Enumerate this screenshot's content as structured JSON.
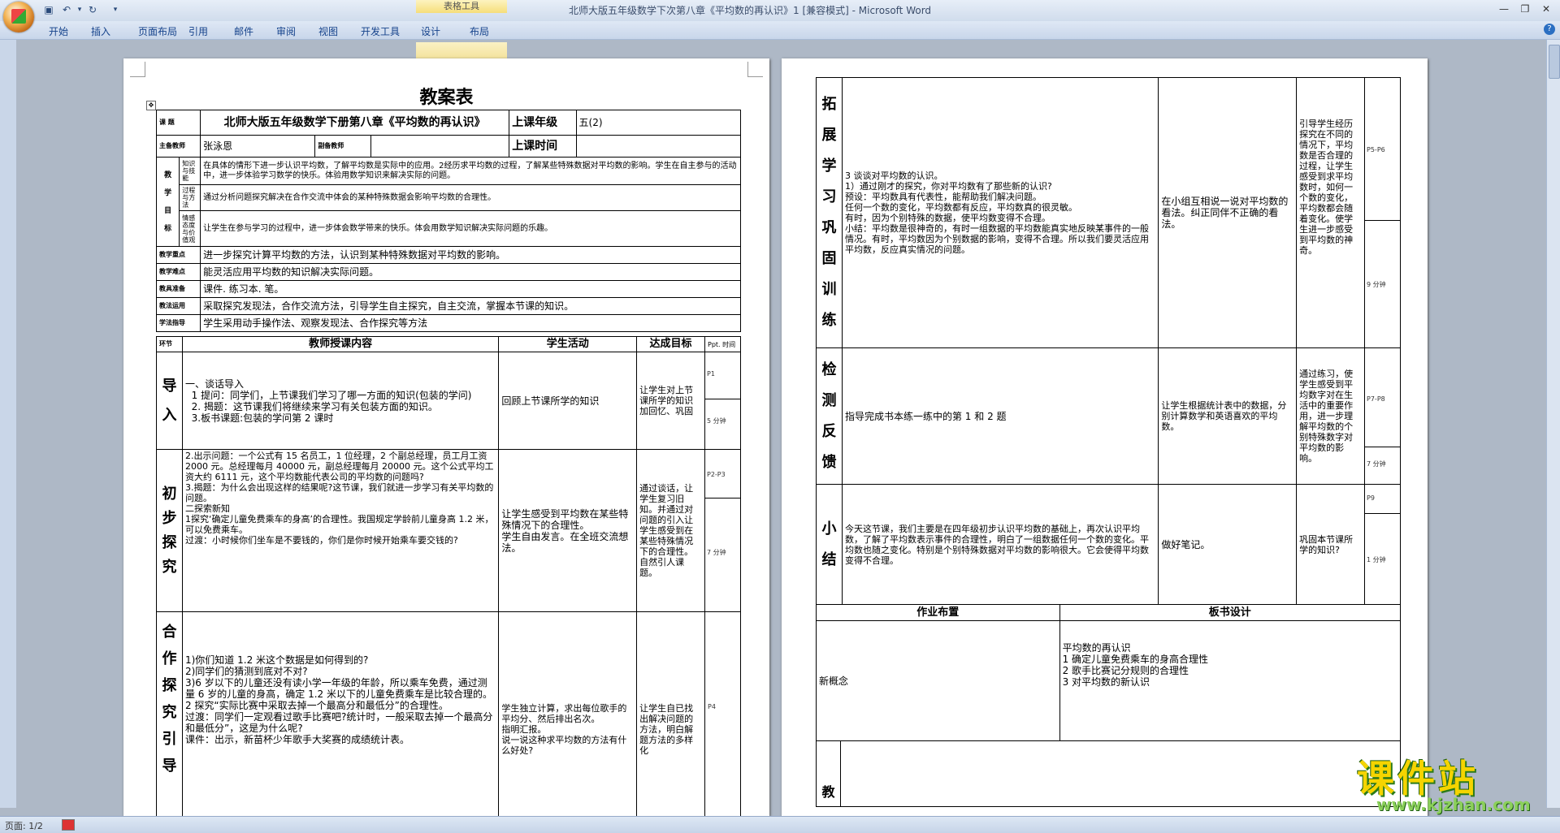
{
  "window": {
    "title": "北师大版五年级数学下次第八章《平均数的再认识》1 [兼容模式] - Microsoft Word",
    "context_group": "表格工具"
  },
  "ribbon": {
    "tabs": [
      "开始",
      "插入",
      "页面布局",
      "引用",
      "邮件",
      "审阅",
      "视图",
      "开发工具",
      "设计",
      "布局"
    ]
  },
  "status": {
    "page": "页面: 1/2"
  },
  "doc": {
    "title": "教案表",
    "row_topic": {
      "label": "课  题",
      "value": "北师大版五年级数学下册第八章《平均数的再认识》",
      "class_label": "上课年级",
      "class_value": "五(2)"
    },
    "row_teacher": {
      "label": "主备教师",
      "value": "张泳恩",
      "assist_label": "副备教师",
      "time_label": "上课时间"
    },
    "goals": {
      "label_chars": [
        "教",
        "学",
        "目",
        "标"
      ],
      "items": [
        {
          "label": "知识与技能",
          "text": "在具体的情形下进一步认识平均数，了解平均数是实际中的应用。2经历求平均数的过程，了解某些特殊数据对平均数的影响。学生在自主参与的活动中，进一步体验学习数学的快乐。体验用数学知识来解决实际的问题。"
        },
        {
          "label": "过程与方法",
          "text": "通过分析问题探究解决在合作交流中体会的某种特殊数据会影响平均数的合理性。"
        },
        {
          "label": "情感态度与价值观",
          "text": "让学生在参与学习的过程中，进一步体会数学带来的快乐。体会用数学知识解决实际问题的乐趣。"
        }
      ]
    },
    "key_rows": [
      {
        "label": "教学重点",
        "text": "进一步探究计算平均数的方法，认识到某种特殊数据对平均数的影响。"
      },
      {
        "label": "教学难点",
        "text": "能灵活应用平均数的知识解决实际问题。"
      },
      {
        "label": "教具准备",
        "text": "课件. 练习本. 笔。"
      },
      {
        "label": "教法运用",
        "text": "采取探究发现法，合作交流方法，引导学生自主探究，自主交流，掌握本节课的知识。"
      },
      {
        "label": "学法指导",
        "text": "学生采用动手操作法、观察发现法、合作探究等方法"
      }
    ],
    "columns": {
      "stage": "环节",
      "teacher": "教师授课内容",
      "student": "学生活动",
      "goal": "达成目标",
      "ppt": "Ppt. 时间"
    },
    "sections_p1": [
      {
        "stage": "导入",
        "teacher": "一、谈话导入\n  1 提问：同学们，上节课我们学习了哪一方面的知识(包装的学问)\n  2. 揭题：这节课我们将继续来学习有关包装方面的知识。\n  3.板书课题:包装的学问第 2 课时",
        "student": "回顾上节课所学的知识",
        "goal": "让学生对上节课所学的知识加回忆、巩固",
        "ppt": "P1",
        "time": "5 分钟"
      },
      {
        "stage": "初步探究",
        "teacher": "2.出示问题：一个公式有 15 名员工，1 位经理，2 个副总经理，员工月工资 2000 元。总经理每月 40000 元，副总经理每月 20000 元。这个公式平均工资大约 6111 元，这个平均数能代表公司的平均数的问题吗?\n3.揭题：为什么会出现这样的结果呢?这节课，我们就进一步学习有关平均数的问题。\n二探索新知\n1探究‘确定儿童免费乘车的身高’的合理性。我国规定学龄前儿童身高 1.2 米，可以免费乘车。\n过渡：小时候你们坐车是不要钱的，你们是你时候开始乘车要交钱的?",
        "student": "让学生感受到平均数在某些特殊情况下的合理性。\n学生自由发言。在全班交流想法。",
        "goal": "通过谈话，让学生复习旧知。并通过对问题的引入让学生感受到在某些特殊情况下的合理性。自然引人课题。",
        "ppt": "P2-P3",
        "time": "7 分钟"
      },
      {
        "stage": "合作探究引导",
        "teacher": "1)你们知道 1.2 米这个数据是如何得到的?\n2)同学们的猜测到底对不对?\n3)6 岁以下的儿童还没有读小学一年级的年龄，所以乘车免费，通过测量 6 岁的儿童的身高，确定 1.2 米以下的儿童免费乘车是比较合理的。\n2 探究“实际比赛中采取去掉一个最高分和最低分”的合理性。\n过渡：同学们一定观看过歌手比赛吧?统计时，一般采取去掉一个最高分和最低分”，这是为什么呢?\n课件：出示，新苗杯少年歌手大奖赛的成绩统计表。",
        "student": "学生独立计算，求出每位歌手的平均分、然后排出名次。\n指明汇报。\n说一说这种求平均数的方法有什么好处?",
        "goal": "让学生自已找出解决问题的方法，明白解题方法的多样化",
        "ppt": "P4",
        "time": ""
      }
    ],
    "sections_p2": [
      {
        "stage": "拓展学习巩固训练",
        "teacher": "3 谈谈对平均数的认识。\n1）通过刚才的探究，你对平均数有了那些新的认识?\n预设：平均数具有代表性，能帮助我们解决问题。\n任何一个数的变化，平均数都有反应，平均数真的很灵敏。\n有时，因为个别特殊的数据，使平均数变得不合理。\n小结：平均数是很神奇的，有时一组数据的平均数能真实地反映某事件的一般情况。有时，平均数因为个别数据的影响，变得不合理。所以我们要灵活应用平均数，反应真实情况的问题。",
        "student": "在小组互相说一说对平均数的看法。纠正同伴不正确的看法。",
        "goal": "引导学生经历探究在不同的情况下，平均数是否合理的过程，让学生感受到求平均数时，如何一个数的变化，平均数都会随着变化。使学生进一步感受到平均数的神奇。",
        "ppt": "P5-P6",
        "time": "9 分钟"
      },
      {
        "stage": "检测反馈",
        "teacher": "指导完成书本练一练中的第 1 和 2 题",
        "student": "让学生根据统计表中的数据，分别计算数学和英语喜欢的平均数。",
        "goal": "通过练习，使学生感受到平均数字对在生活中的重要作用，进一步理解平均数的个别特殊数字对平均数的影响。",
        "ppt": "P7-P8",
        "time": "7 分钟"
      },
      {
        "stage": "小结",
        "teacher": "今天这节课，我们主要是在四年级初步认识平均数的基础上，再次认识平均数，了解了平均数表示事件的合理性，明白了一组数据任何一个数的变化。平均数也随之变化。特别是个别特殊数据对平均数的影响很大。它会使得平均数变得不合理。",
        "student": "做好笔记。",
        "goal": "巩固本节课所学的知识?",
        "ppt": "P9",
        "time": "1 分钟"
      }
    ],
    "homework": {
      "label": "作业布置",
      "value": "新概念"
    },
    "board": {
      "label": "板书设计",
      "lines": [
        "平均数的再认识",
        "1 确定儿童免费乘车的身高合理性",
        "2 歌手比赛记分规则的合理性",
        "3 对平均数的新认识"
      ]
    },
    "bottom_stage": "教"
  },
  "watermark": {
    "text": "课件站",
    "url": "www.kjzhan.com"
  }
}
